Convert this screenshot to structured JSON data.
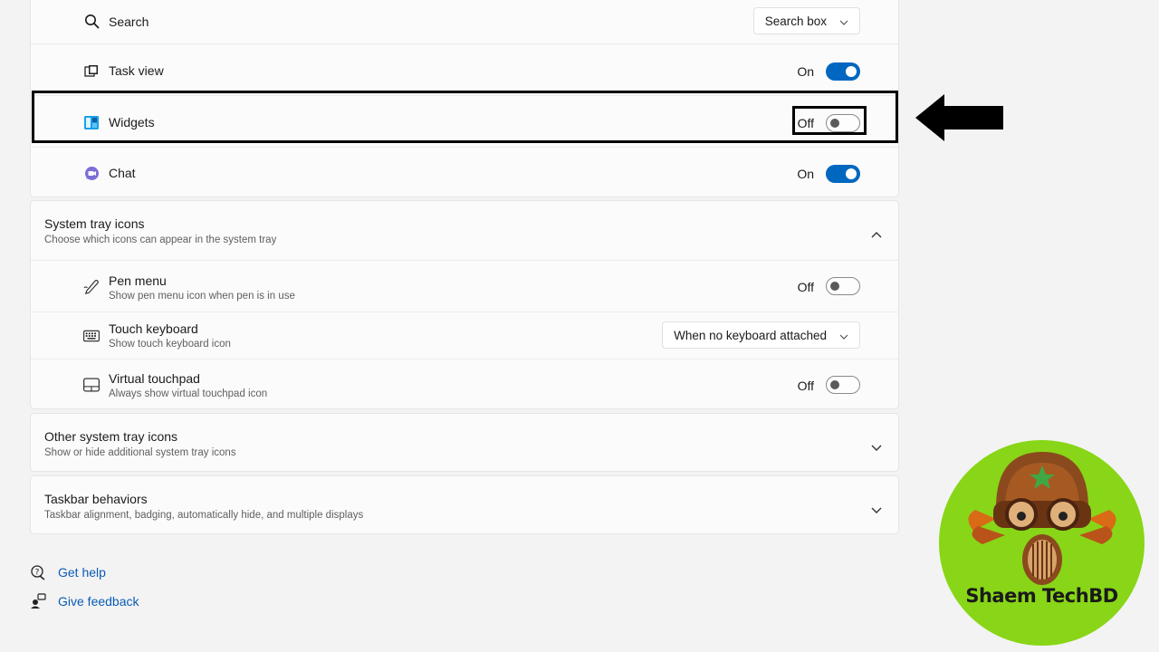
{
  "taskbar_items": [
    {
      "label": "Search",
      "icon": "search-icon",
      "control": "dropdown",
      "value": "Search box"
    },
    {
      "label": "Task view",
      "icon": "task-view-icon",
      "control": "toggle",
      "state": "On"
    },
    {
      "label": "Widgets",
      "icon": "widgets-icon",
      "control": "toggle",
      "state": "Off"
    },
    {
      "label": "Chat",
      "icon": "chat-icon",
      "control": "toggle",
      "state": "On"
    }
  ],
  "system_tray": {
    "title": "System tray icons",
    "subtitle": "Choose which icons can appear in the system tray",
    "items": [
      {
        "label": "Pen menu",
        "sub": "Show pen menu icon when pen is in use",
        "icon": "pen-icon",
        "state": "Off"
      },
      {
        "label": "Touch keyboard",
        "sub": "Show touch keyboard icon",
        "icon": "keyboard-icon",
        "value": "When no keyboard attached"
      },
      {
        "label": "Virtual touchpad",
        "sub": "Always show virtual touchpad icon",
        "icon": "touchpad-icon",
        "state": "Off"
      }
    ]
  },
  "other_tray": {
    "title": "Other system tray icons",
    "subtitle": "Show or hide additional system tray icons"
  },
  "behaviors": {
    "title": "Taskbar behaviors",
    "subtitle": "Taskbar alignment, badging, automatically hide, and multiple displays"
  },
  "links": {
    "help": "Get help",
    "feedback": "Give feedback"
  },
  "watermark": {
    "text": "Shaem TechBD"
  },
  "colors": {
    "accent": "#0067c0",
    "link": "#0a5bb5",
    "logo_bg": "#88d617"
  }
}
